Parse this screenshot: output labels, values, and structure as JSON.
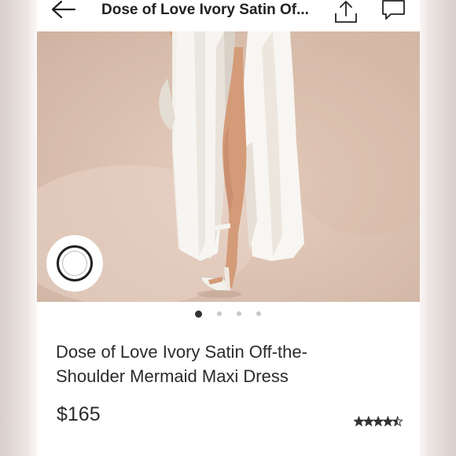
{
  "header": {
    "title": "Dose of Love Ivory Satin Of...",
    "back_icon": "arrow-left-icon",
    "share_icon": "share-icon",
    "comment_icon": "comment-icon"
  },
  "gallery": {
    "image_count": 4,
    "active_index": 0,
    "swatch_color": "#ffffff"
  },
  "product": {
    "title_line1": "Dose of Love Ivory Satin Off-the-",
    "title_line2": "Shoulder Mermaid Maxi Dress",
    "price": "$165",
    "rating": 4.5,
    "rating_max": 5
  },
  "colors": {
    "text": "#2b2b2b",
    "dot_active": "#333333",
    "dot_inactive": "#c8c8c8"
  }
}
